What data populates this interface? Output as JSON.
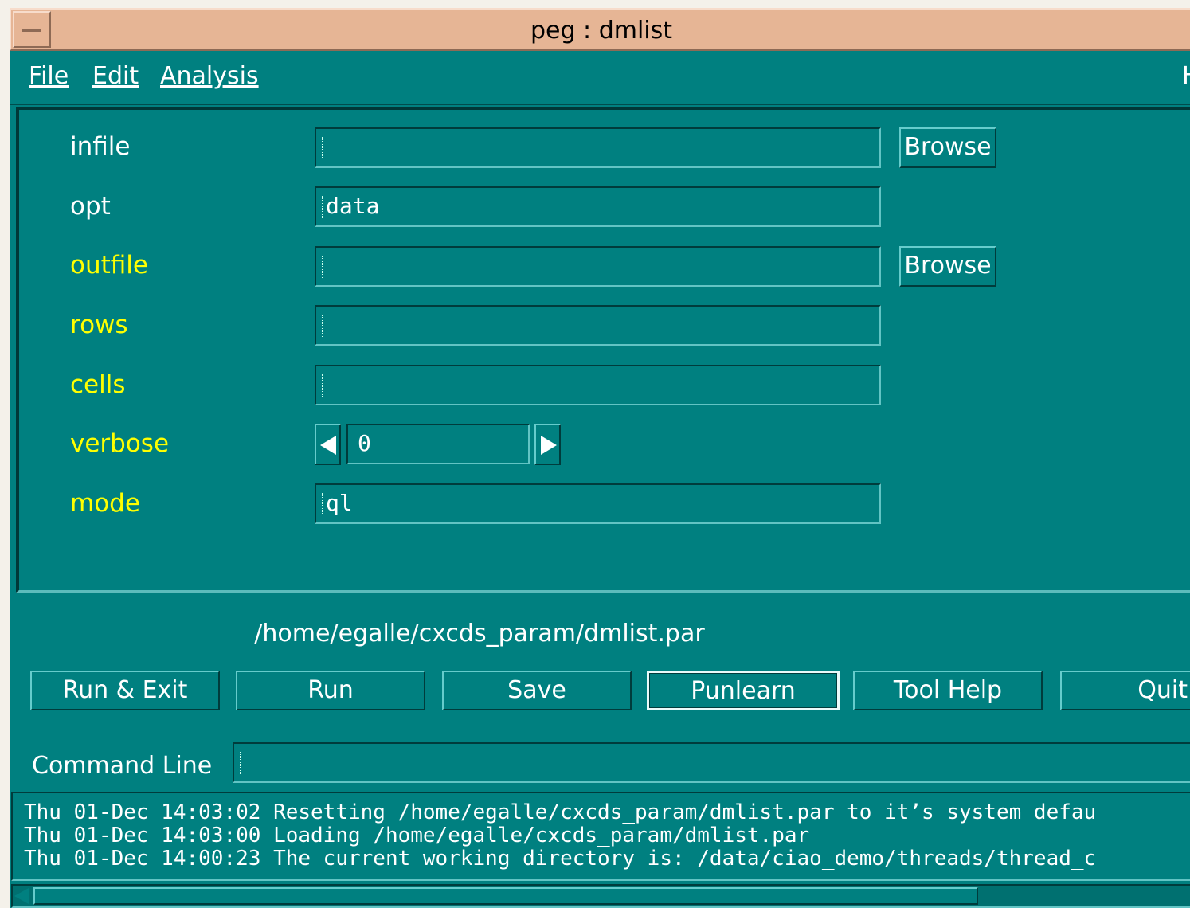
{
  "window": {
    "title": "peg : dmlist"
  },
  "menubar": {
    "file": "File",
    "edit": "Edit",
    "analysis": "Analysis",
    "help": "H"
  },
  "params": [
    {
      "name": "infile",
      "value": "",
      "browse": "Browse",
      "required": true
    },
    {
      "name": "opt",
      "value": "data",
      "required": true
    },
    {
      "name": "outfile",
      "value": "",
      "browse": "Browse",
      "required": false
    },
    {
      "name": "rows",
      "value": "",
      "required": false
    },
    {
      "name": "cells",
      "value": "",
      "required": false
    },
    {
      "name": "verbose",
      "value": "0",
      "required": false
    },
    {
      "name": "mode",
      "value": "ql",
      "required": false
    }
  ],
  "param_file": "/home/egalle/cxcds_param/dmlist.par",
  "buttons": {
    "run_exit": "Run & Exit",
    "run": "Run",
    "save": "Save",
    "punlearn": "Punlearn",
    "tool_help": "Tool Help",
    "quit": "Quit"
  },
  "command_line": {
    "label": "Command Line",
    "value": ""
  },
  "log": [
    "Thu 01-Dec 14:03:02 Resetting /home/egalle/cxcds_param/dmlist.par to it’s system defau",
    "Thu 01-Dec 14:03:00 Loading /home/egalle/cxcds_param/dmlist.par",
    "Thu 01-Dec 14:00:23 The current working directory is: /data/ciao_demo/threads/thread_c"
  ],
  "colors": {
    "background": "#008080",
    "titlebar": "#e6b595",
    "required_label": "#ffffff",
    "optional_label": "#ffff00"
  }
}
